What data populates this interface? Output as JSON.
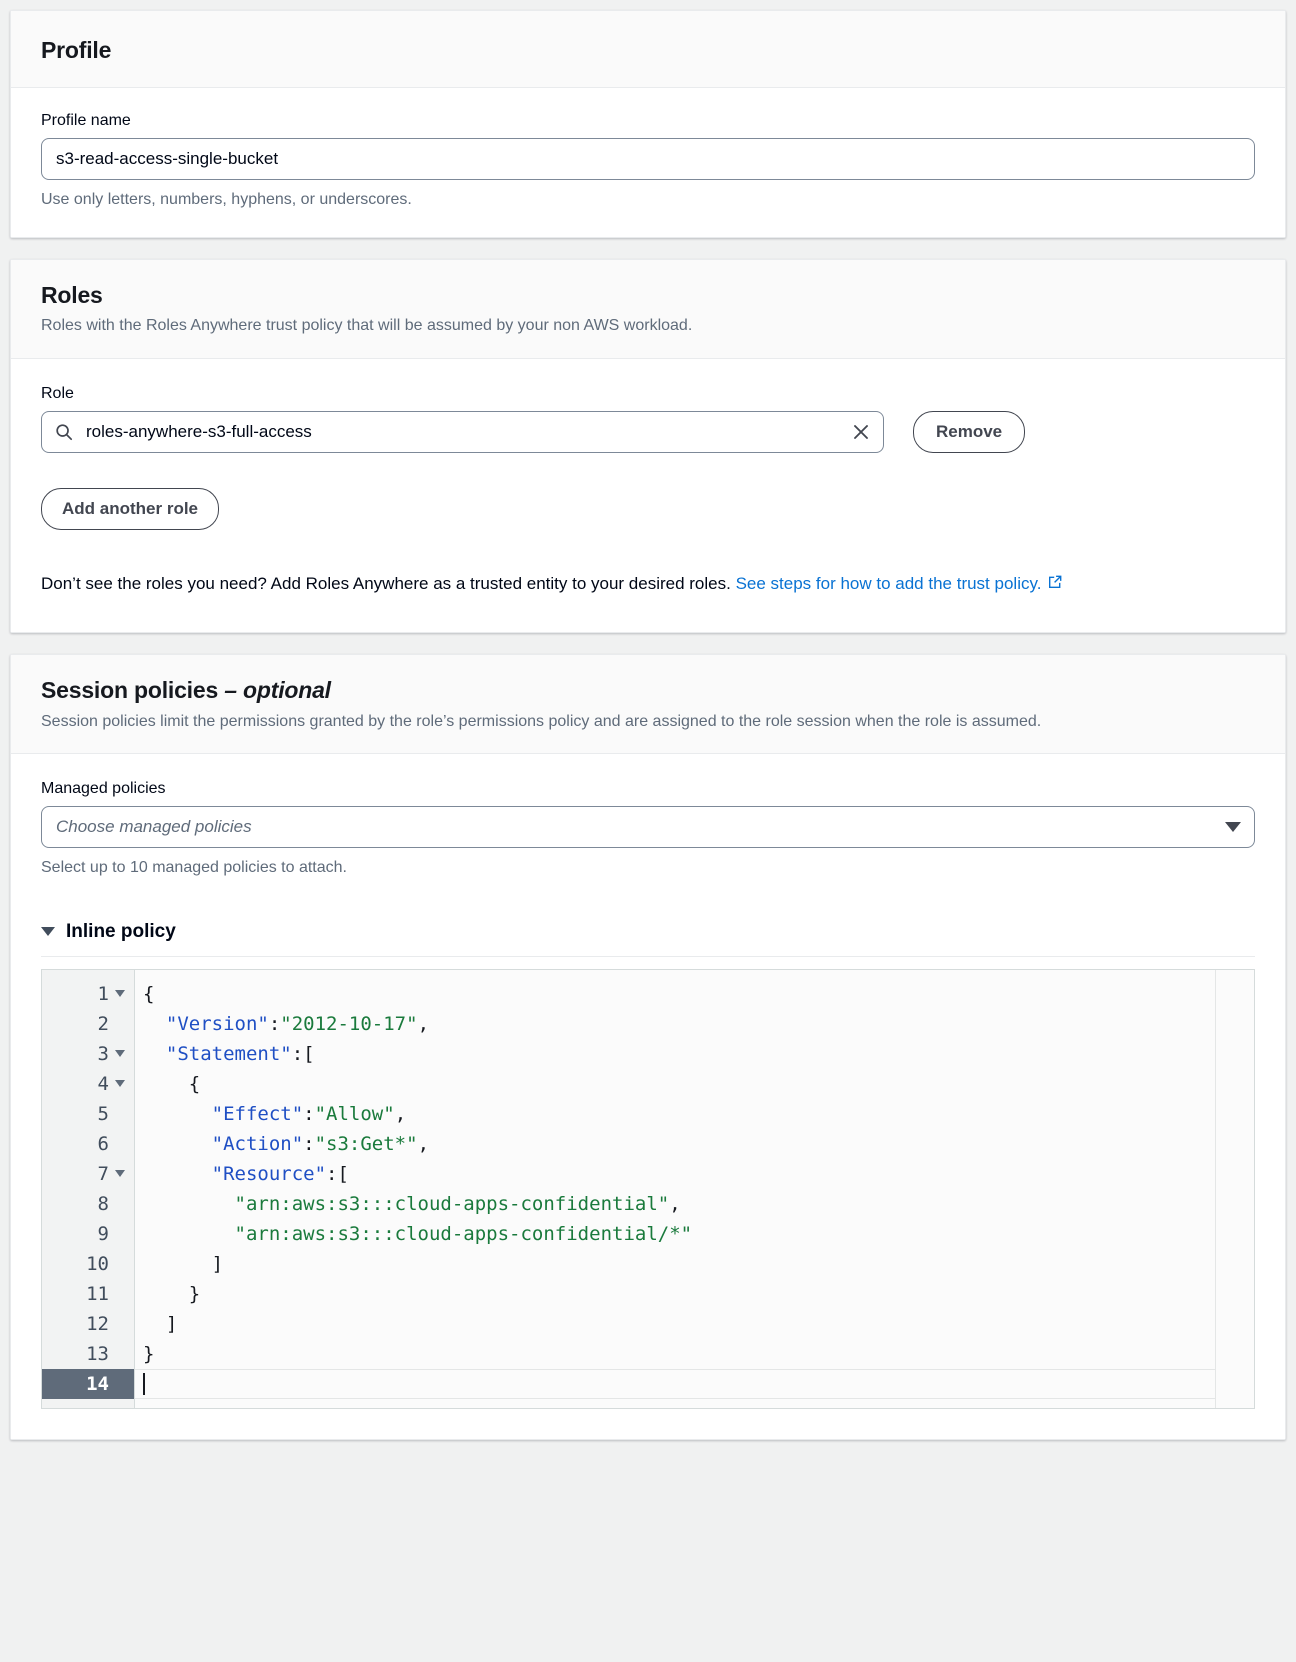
{
  "profile_card": {
    "title": "Profile",
    "name_label": "Profile name",
    "name_value": "s3-read-access-single-bucket",
    "name_placeholder": "",
    "name_hint": "Use only letters, numbers, hyphens, or underscores."
  },
  "roles_card": {
    "title": "Roles",
    "description": "Roles with the Roles Anywhere trust policy that will be assumed by your non AWS workload.",
    "role_label": "Role",
    "role_value": "roles-anywhere-s3-full-access",
    "role_placeholder": "",
    "search_icon": "search-icon",
    "clear_icon": "close-icon",
    "remove_label": "Remove",
    "add_label": "Add another role",
    "note_text": "Don’t see the roles you need? Add Roles Anywhere as a trusted entity to your desired roles. ",
    "note_link": "See steps for how to add the trust policy.",
    "external_icon": "external-link-icon"
  },
  "session_card": {
    "title": "Session policies",
    "title_optional": "– optional",
    "description": "Session policies limit the permissions granted by the role’s permissions policy and are assigned to the role session when the role is assumed.",
    "managed_label": "Managed policies",
    "managed_placeholder": "Choose managed policies",
    "managed_hint": "Select up to 10 managed policies to attach.",
    "caret_icon": "chevron-down-icon"
  },
  "inline_policy": {
    "section_title": "Inline policy",
    "toggle_icon": "triangle-down-icon",
    "active_line": 14,
    "lines": [
      {
        "n": 1,
        "fold": true,
        "tokens": [
          {
            "t": "punc",
            "v": "{"
          }
        ]
      },
      {
        "n": 2,
        "fold": false,
        "tokens": [
          {
            "t": "punc",
            "v": "  "
          },
          {
            "t": "key",
            "v": "\"Version\""
          },
          {
            "t": "punc",
            "v": ":"
          },
          {
            "t": "str",
            "v": "\"2012-10-17\""
          },
          {
            "t": "punc",
            "v": ","
          }
        ]
      },
      {
        "n": 3,
        "fold": true,
        "tokens": [
          {
            "t": "punc",
            "v": "  "
          },
          {
            "t": "key",
            "v": "\"Statement\""
          },
          {
            "t": "punc",
            "v": ":["
          }
        ]
      },
      {
        "n": 4,
        "fold": true,
        "tokens": [
          {
            "t": "punc",
            "v": "    {"
          }
        ]
      },
      {
        "n": 5,
        "fold": false,
        "tokens": [
          {
            "t": "punc",
            "v": "      "
          },
          {
            "t": "key",
            "v": "\"Effect\""
          },
          {
            "t": "punc",
            "v": ":"
          },
          {
            "t": "str",
            "v": "\"Allow\""
          },
          {
            "t": "punc",
            "v": ","
          }
        ]
      },
      {
        "n": 6,
        "fold": false,
        "tokens": [
          {
            "t": "punc",
            "v": "      "
          },
          {
            "t": "key",
            "v": "\"Action\""
          },
          {
            "t": "punc",
            "v": ":"
          },
          {
            "t": "str",
            "v": "\"s3:Get*\""
          },
          {
            "t": "punc",
            "v": ","
          }
        ]
      },
      {
        "n": 7,
        "fold": true,
        "tokens": [
          {
            "t": "punc",
            "v": "      "
          },
          {
            "t": "key",
            "v": "\"Resource\""
          },
          {
            "t": "punc",
            "v": ":["
          }
        ]
      },
      {
        "n": 8,
        "fold": false,
        "tokens": [
          {
            "t": "punc",
            "v": "        "
          },
          {
            "t": "str",
            "v": "\"arn:aws:s3:::cloud-apps-confidential\""
          },
          {
            "t": "punc",
            "v": ","
          }
        ]
      },
      {
        "n": 9,
        "fold": false,
        "tokens": [
          {
            "t": "punc",
            "v": "        "
          },
          {
            "t": "str",
            "v": "\"arn:aws:s3:::cloud-apps-confidential/*\""
          }
        ]
      },
      {
        "n": 10,
        "fold": false,
        "tokens": [
          {
            "t": "punc",
            "v": "      ]"
          }
        ]
      },
      {
        "n": 11,
        "fold": false,
        "tokens": [
          {
            "t": "punc",
            "v": "    }"
          }
        ]
      },
      {
        "n": 12,
        "fold": false,
        "tokens": [
          {
            "t": "punc",
            "v": "  ]"
          }
        ]
      },
      {
        "n": 13,
        "fold": false,
        "tokens": [
          {
            "t": "punc",
            "v": "}"
          }
        ]
      },
      {
        "n": 14,
        "fold": false,
        "tokens": []
      }
    ],
    "policy_json": {
      "Version": "2012-10-17",
      "Statement": [
        {
          "Effect": "Allow",
          "Action": "s3:Get*",
          "Resource": [
            "arn:aws:s3:::cloud-apps-confidential",
            "arn:aws:s3:::cloud-apps-confidential/*"
          ]
        }
      ]
    }
  },
  "colors": {
    "page_bg": "#f0f1f1",
    "card_bg": "#ffffff",
    "header_bg": "#fafafa",
    "link": "#0972d3",
    "text": "#000716",
    "muted": "#5f6b7a",
    "border": "#7d8998",
    "json_key": "#1f4fc4",
    "json_string": "#1a7a3c",
    "active_gutter": "#5f6b7a"
  }
}
